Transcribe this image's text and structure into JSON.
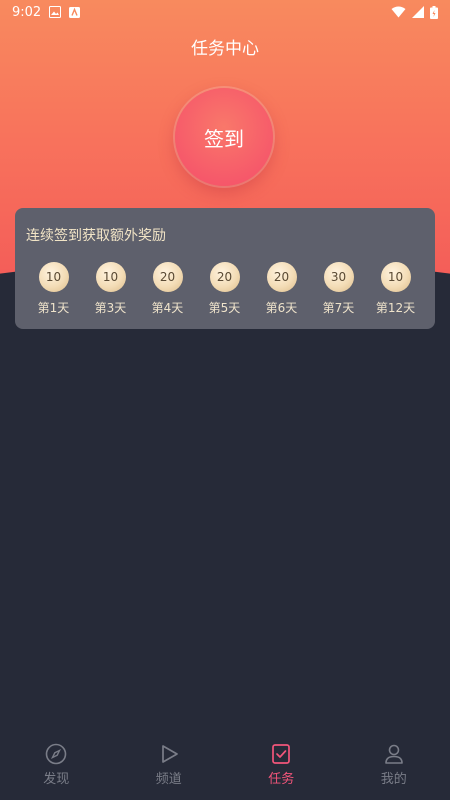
{
  "status_bar": {
    "time": "9:02"
  },
  "header": {
    "title": "任务中心"
  },
  "checkin": {
    "label": "签到"
  },
  "rewards": {
    "title": "连续签到获取额外奖励",
    "days": [
      {
        "coins": "10",
        "label": "第1天"
      },
      {
        "coins": "10",
        "label": "第3天"
      },
      {
        "coins": "20",
        "label": "第4天"
      },
      {
        "coins": "20",
        "label": "第5天"
      },
      {
        "coins": "20",
        "label": "第6天"
      },
      {
        "coins": "30",
        "label": "第7天"
      },
      {
        "coins": "10",
        "label": "第12天"
      }
    ]
  },
  "bottom_nav": {
    "active": "任务",
    "items": [
      {
        "label": "发现",
        "icon": "compass-icon"
      },
      {
        "label": "频道",
        "icon": "play-icon"
      },
      {
        "label": "任务",
        "icon": "task-check-icon"
      },
      {
        "label": "我的",
        "icon": "user-icon"
      }
    ]
  },
  "colors": {
    "accent": "#f2557a",
    "background": "#262a38",
    "card": "#5e606c",
    "hero_top": "#f88a5e",
    "hero_bottom": "#f35a58"
  }
}
